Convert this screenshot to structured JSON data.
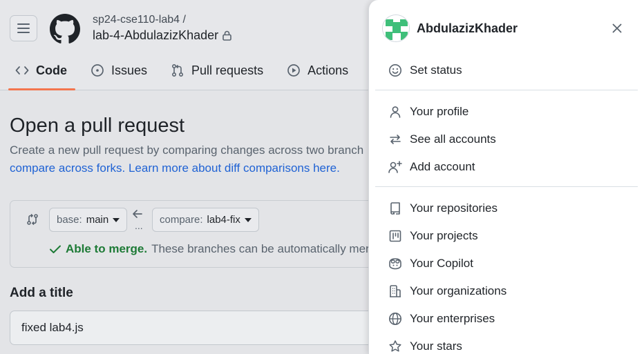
{
  "header": {
    "repo_owner": "sp24-cse110-lab4 /",
    "repo_name": "lab-4-AbdulazizKhader"
  },
  "tabs": [
    {
      "label": "Code",
      "icon": "code-icon",
      "active": true
    },
    {
      "label": "Issues",
      "icon": "issue-icon",
      "active": false
    },
    {
      "label": "Pull requests",
      "icon": "pull-request-icon",
      "active": false
    },
    {
      "label": "Actions",
      "icon": "play-icon",
      "active": false
    }
  ],
  "main": {
    "title": "Open a pull request",
    "desc_line1": "Create a new pull request by comparing changes across two branch",
    "link1": "compare across forks.",
    "link2": "Learn more about diff comparisons here.",
    "base_prefix": "base:",
    "base_value": "main",
    "compare_prefix": "compare:",
    "compare_value": "lab4-fix",
    "dots": "...",
    "merge_ok": "Able to merge.",
    "merge_rest": "These branches can be automatically mer",
    "add_title_label": "Add a title",
    "title_value": "fixed lab4.js"
  },
  "panel": {
    "username": "AbdulazizKhader",
    "items": [
      {
        "label": "Set status",
        "icon": "smiley-icon"
      },
      {
        "label": "Your profile",
        "icon": "person-icon"
      },
      {
        "label": "See all accounts",
        "icon": "arrow-switch-icon"
      },
      {
        "label": "Add account",
        "icon": "person-add-icon"
      },
      {
        "label": "Your repositories",
        "icon": "repo-icon"
      },
      {
        "label": "Your projects",
        "icon": "project-icon"
      },
      {
        "label": "Your Copilot",
        "icon": "copilot-icon"
      },
      {
        "label": "Your organizations",
        "icon": "organization-icon"
      },
      {
        "label": "Your enterprises",
        "icon": "globe-icon"
      },
      {
        "label": "Your stars",
        "icon": "star-icon"
      }
    ]
  },
  "colors": {
    "accent_underline": "#f3754e",
    "link": "#1f62d4",
    "merge_green": "#1d7a36",
    "avatar_green": "#3fbf7a"
  }
}
